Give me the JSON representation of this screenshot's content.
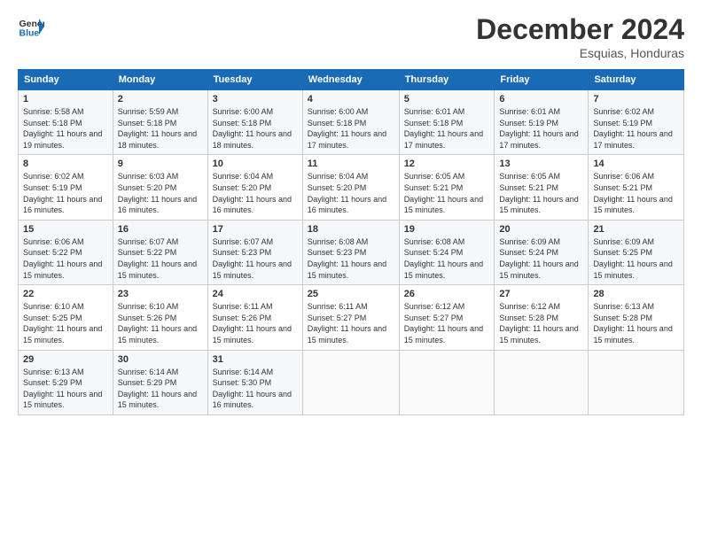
{
  "header": {
    "logo_line1": "General",
    "logo_line2": "Blue",
    "month": "December 2024",
    "location": "Esquias, Honduras"
  },
  "days_of_week": [
    "Sunday",
    "Monday",
    "Tuesday",
    "Wednesday",
    "Thursday",
    "Friday",
    "Saturday"
  ],
  "weeks": [
    [
      {
        "day": "1",
        "sunrise": "5:58 AM",
        "sunset": "5:18 PM",
        "daylight": "11 hours and 19 minutes."
      },
      {
        "day": "2",
        "sunrise": "5:59 AM",
        "sunset": "5:18 PM",
        "daylight": "11 hours and 18 minutes."
      },
      {
        "day": "3",
        "sunrise": "6:00 AM",
        "sunset": "5:18 PM",
        "daylight": "11 hours and 18 minutes."
      },
      {
        "day": "4",
        "sunrise": "6:00 AM",
        "sunset": "5:18 PM",
        "daylight": "11 hours and 17 minutes."
      },
      {
        "day": "5",
        "sunrise": "6:01 AM",
        "sunset": "5:18 PM",
        "daylight": "11 hours and 17 minutes."
      },
      {
        "day": "6",
        "sunrise": "6:01 AM",
        "sunset": "5:19 PM",
        "daylight": "11 hours and 17 minutes."
      },
      {
        "day": "7",
        "sunrise": "6:02 AM",
        "sunset": "5:19 PM",
        "daylight": "11 hours and 17 minutes."
      }
    ],
    [
      {
        "day": "8",
        "sunrise": "6:02 AM",
        "sunset": "5:19 PM",
        "daylight": "11 hours and 16 minutes."
      },
      {
        "day": "9",
        "sunrise": "6:03 AM",
        "sunset": "5:20 PM",
        "daylight": "11 hours and 16 minutes."
      },
      {
        "day": "10",
        "sunrise": "6:04 AM",
        "sunset": "5:20 PM",
        "daylight": "11 hours and 16 minutes."
      },
      {
        "day": "11",
        "sunrise": "6:04 AM",
        "sunset": "5:20 PM",
        "daylight": "11 hours and 16 minutes."
      },
      {
        "day": "12",
        "sunrise": "6:05 AM",
        "sunset": "5:21 PM",
        "daylight": "11 hours and 15 minutes."
      },
      {
        "day": "13",
        "sunrise": "6:05 AM",
        "sunset": "5:21 PM",
        "daylight": "11 hours and 15 minutes."
      },
      {
        "day": "14",
        "sunrise": "6:06 AM",
        "sunset": "5:21 PM",
        "daylight": "11 hours and 15 minutes."
      }
    ],
    [
      {
        "day": "15",
        "sunrise": "6:06 AM",
        "sunset": "5:22 PM",
        "daylight": "11 hours and 15 minutes."
      },
      {
        "day": "16",
        "sunrise": "6:07 AM",
        "sunset": "5:22 PM",
        "daylight": "11 hours and 15 minutes."
      },
      {
        "day": "17",
        "sunrise": "6:07 AM",
        "sunset": "5:23 PM",
        "daylight": "11 hours and 15 minutes."
      },
      {
        "day": "18",
        "sunrise": "6:08 AM",
        "sunset": "5:23 PM",
        "daylight": "11 hours and 15 minutes."
      },
      {
        "day": "19",
        "sunrise": "6:08 AM",
        "sunset": "5:24 PM",
        "daylight": "11 hours and 15 minutes."
      },
      {
        "day": "20",
        "sunrise": "6:09 AM",
        "sunset": "5:24 PM",
        "daylight": "11 hours and 15 minutes."
      },
      {
        "day": "21",
        "sunrise": "6:09 AM",
        "sunset": "5:25 PM",
        "daylight": "11 hours and 15 minutes."
      }
    ],
    [
      {
        "day": "22",
        "sunrise": "6:10 AM",
        "sunset": "5:25 PM",
        "daylight": "11 hours and 15 minutes."
      },
      {
        "day": "23",
        "sunrise": "6:10 AM",
        "sunset": "5:26 PM",
        "daylight": "11 hours and 15 minutes."
      },
      {
        "day": "24",
        "sunrise": "6:11 AM",
        "sunset": "5:26 PM",
        "daylight": "11 hours and 15 minutes."
      },
      {
        "day": "25",
        "sunrise": "6:11 AM",
        "sunset": "5:27 PM",
        "daylight": "11 hours and 15 minutes."
      },
      {
        "day": "26",
        "sunrise": "6:12 AM",
        "sunset": "5:27 PM",
        "daylight": "11 hours and 15 minutes."
      },
      {
        "day": "27",
        "sunrise": "6:12 AM",
        "sunset": "5:28 PM",
        "daylight": "11 hours and 15 minutes."
      },
      {
        "day": "28",
        "sunrise": "6:13 AM",
        "sunset": "5:28 PM",
        "daylight": "11 hours and 15 minutes."
      }
    ],
    [
      {
        "day": "29",
        "sunrise": "6:13 AM",
        "sunset": "5:29 PM",
        "daylight": "11 hours and 15 minutes."
      },
      {
        "day": "30",
        "sunrise": "6:14 AM",
        "sunset": "5:29 PM",
        "daylight": "11 hours and 15 minutes."
      },
      {
        "day": "31",
        "sunrise": "6:14 AM",
        "sunset": "5:30 PM",
        "daylight": "11 hours and 16 minutes."
      },
      null,
      null,
      null,
      null
    ]
  ],
  "labels": {
    "sunrise": "Sunrise:",
    "sunset": "Sunset:",
    "daylight": "Daylight:"
  }
}
